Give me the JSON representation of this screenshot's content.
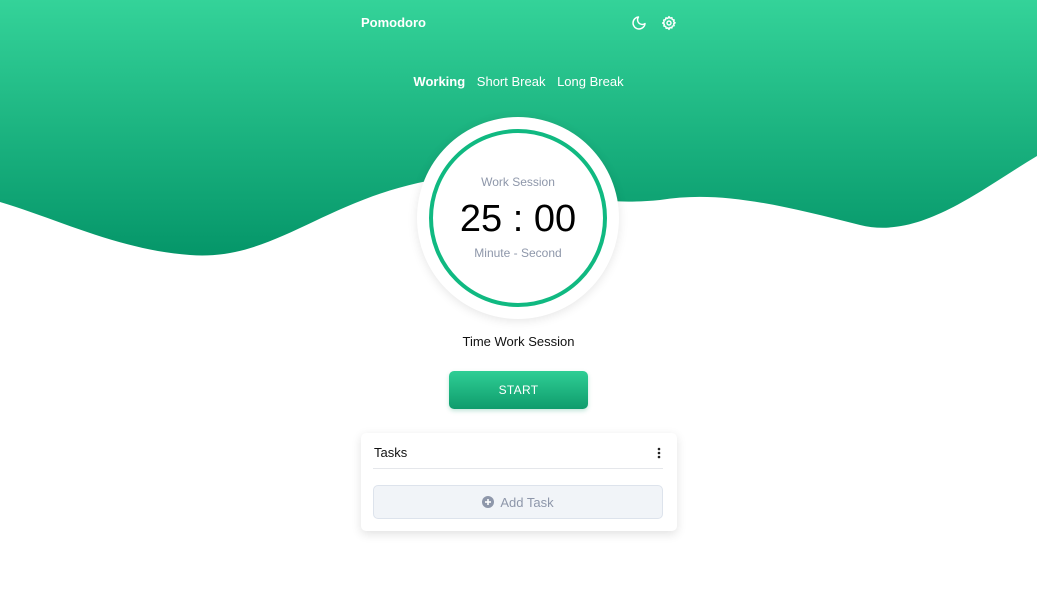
{
  "app": {
    "title": "Pomodoro",
    "icons": [
      "moon-icon",
      "gear-icon"
    ]
  },
  "tabs": [
    {
      "label": "Working",
      "active": true
    },
    {
      "label": "Short Break",
      "active": false
    },
    {
      "label": "Long Break",
      "active": false
    }
  ],
  "timer": {
    "session_label": "Work Session",
    "time": "25 : 00",
    "subtitle": "Minute - Second"
  },
  "session_caption": "Time Work Session",
  "start_button": "START",
  "tasks": {
    "title": "Tasks",
    "add_label": "Add Task",
    "icons": [
      "more-vertical-icon",
      "plus-circle-icon"
    ]
  },
  "colors": {
    "accent": "#10b981",
    "wave_top": "#34d399",
    "wave_bottom": "#059669",
    "muted_text": "#8e97aa"
  }
}
